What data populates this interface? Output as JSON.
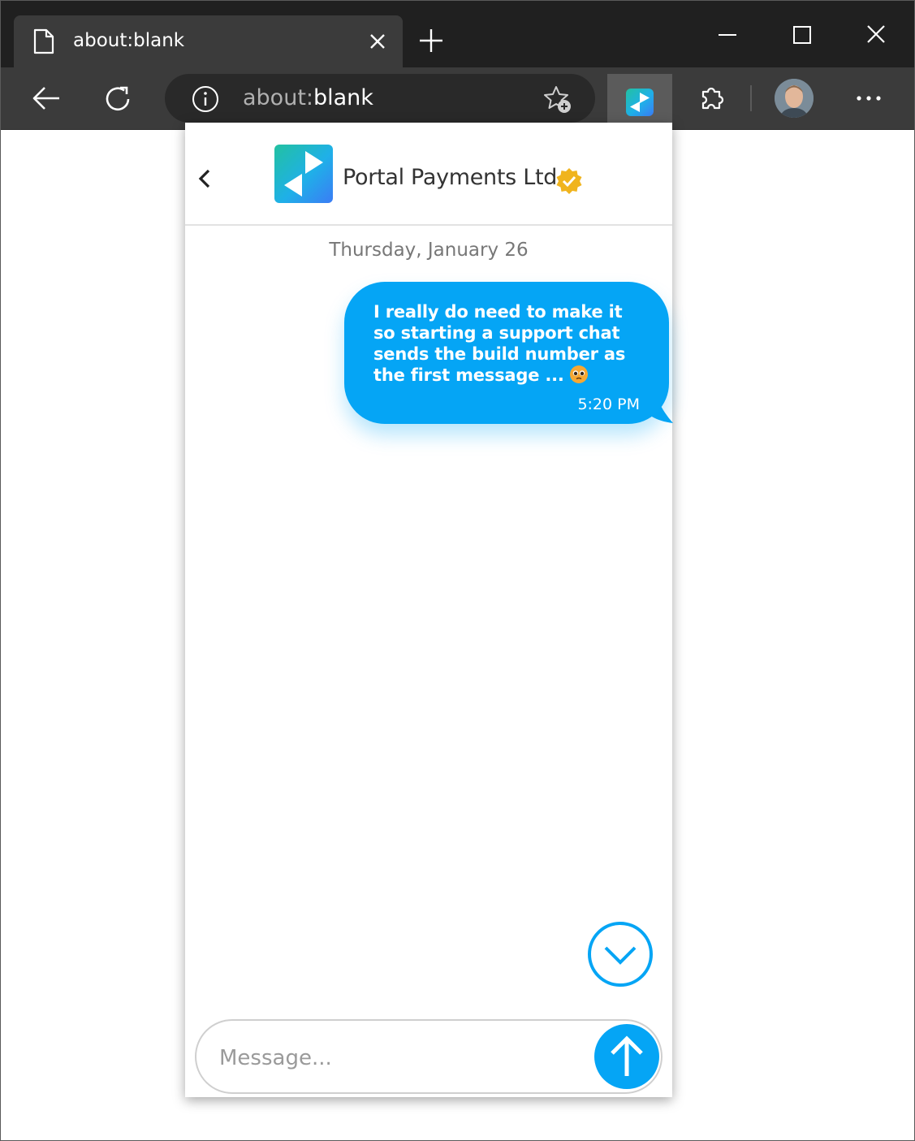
{
  "browser": {
    "tab": {
      "title": "about:blank"
    },
    "address_bar": {
      "protocol": "about:",
      "path": "blank"
    }
  },
  "chat": {
    "company_name": "Portal Payments Ltd.",
    "date": "Thursday, January 26",
    "messages": [
      {
        "text": "I really do need to make it so starting a support chat sends the build number as the first message ...",
        "emoji": "pleading-face",
        "time": "5:20 PM",
        "direction": "outgoing"
      }
    ],
    "input_placeholder": "Message..."
  },
  "colors": {
    "accent": "#05a5f5",
    "browser_titlebar": "#202020",
    "browser_toolbar": "#3b3b3b",
    "verified_badge": "#f0b41e"
  }
}
